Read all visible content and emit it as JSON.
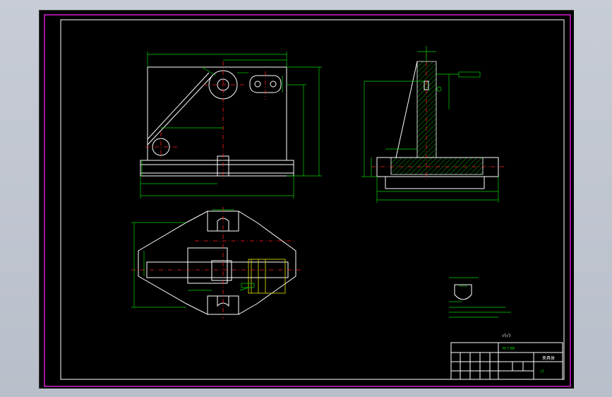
{
  "drawing": {
    "scale_note": "M 7:88",
    "part_name": "夹具体",
    "sheet_code": "J1",
    "surface_symbol": "√(√)"
  },
  "colors": {
    "background": "#000000",
    "frame": "#e020e0",
    "outline": "#ffffff",
    "dimension": "#00d400",
    "centerline": "#ff2020",
    "hidden": "#e6e600"
  }
}
